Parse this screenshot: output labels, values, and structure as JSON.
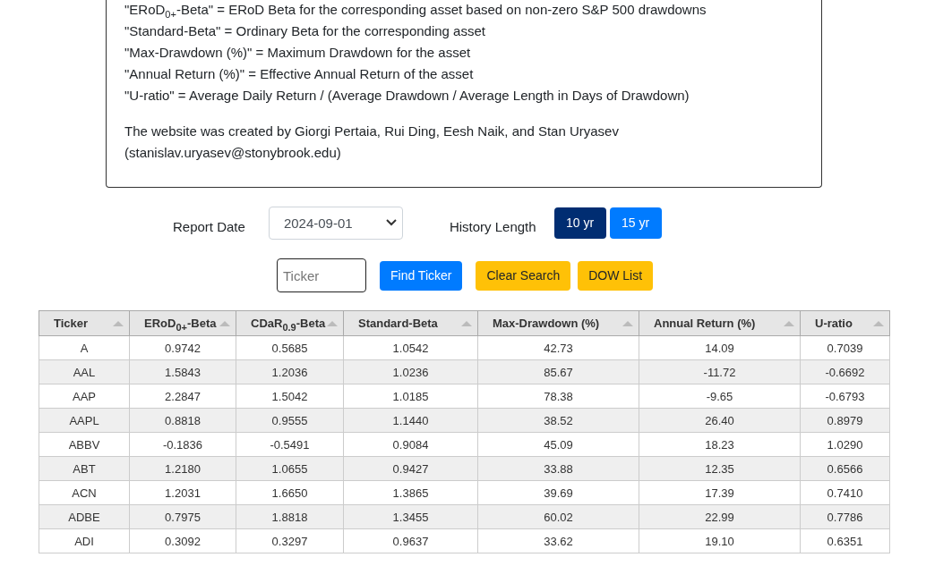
{
  "info": {
    "lines": [
      "\"ERoD$_{0+}$-Beta\" = ERoD Beta for the corresponding asset based on non-zero S&P 500 drawdowns",
      "\"Standard-Beta\" = Ordinary Beta for the corresponding asset",
      "\"Max-Drawdown (%)\" = Maximum Drawdown for the asset",
      "\"Annual Return (%)\" = Effective Annual Return of the asset",
      "\"U-ratio\" = Average Daily Return / (Average Drawdown / Average Length in Days of Drawdown)"
    ],
    "credit": "The website was created by Giorgi Pertaia, Rui Ding, Eesh Naik, and Stan Uryasev (stanislav.uryasev@stonybrook.edu)"
  },
  "report_date": {
    "label": "Report Date",
    "value": "2024-09-01"
  },
  "history": {
    "label": "History Length",
    "options": [
      {
        "label": "10 yr",
        "selected": true
      },
      {
        "label": "15 yr",
        "selected": false
      }
    ]
  },
  "search": {
    "placeholder": "Ticker",
    "buttons": [
      {
        "label": "Find Ticker",
        "kind": "primary"
      },
      {
        "label": "Clear Search",
        "kind": "warning"
      },
      {
        "label": "DOW List",
        "kind": "warning"
      }
    ]
  },
  "table": {
    "columns": [
      "Ticker",
      "ERoD$_{0+}$-Beta",
      "CDaR$_{0.9}$-Beta",
      "Standard-Beta",
      "Max-Drawdown (%)",
      "Annual Return (%)",
      "U-ratio"
    ],
    "rows": [
      [
        "A",
        "0.9742",
        "0.5685",
        "1.0542",
        "42.73",
        "14.09",
        "0.7039"
      ],
      [
        "AAL",
        "1.5843",
        "1.2036",
        "1.0236",
        "85.67",
        "-11.72",
        "-0.6692"
      ],
      [
        "AAP",
        "2.2847",
        "1.5042",
        "1.0185",
        "78.38",
        "-9.65",
        "-0.6793"
      ],
      [
        "AAPL",
        "0.8818",
        "0.9555",
        "1.1440",
        "38.52",
        "26.40",
        "0.8979"
      ],
      [
        "ABBV",
        "-0.1836",
        "-0.5491",
        "0.9084",
        "45.09",
        "18.23",
        "1.0290"
      ],
      [
        "ABT",
        "1.2180",
        "1.0655",
        "0.9427",
        "33.88",
        "12.35",
        "0.6566"
      ],
      [
        "ACN",
        "1.2031",
        "1.6650",
        "1.3865",
        "39.69",
        "17.39",
        "0.7410"
      ],
      [
        "ADBE",
        "0.7975",
        "1.8818",
        "1.3455",
        "60.02",
        "22.99",
        "0.7786"
      ],
      [
        "ADI",
        "0.3092",
        "0.3297",
        "0.9637",
        "33.62",
        "19.10",
        "0.6351"
      ]
    ]
  }
}
